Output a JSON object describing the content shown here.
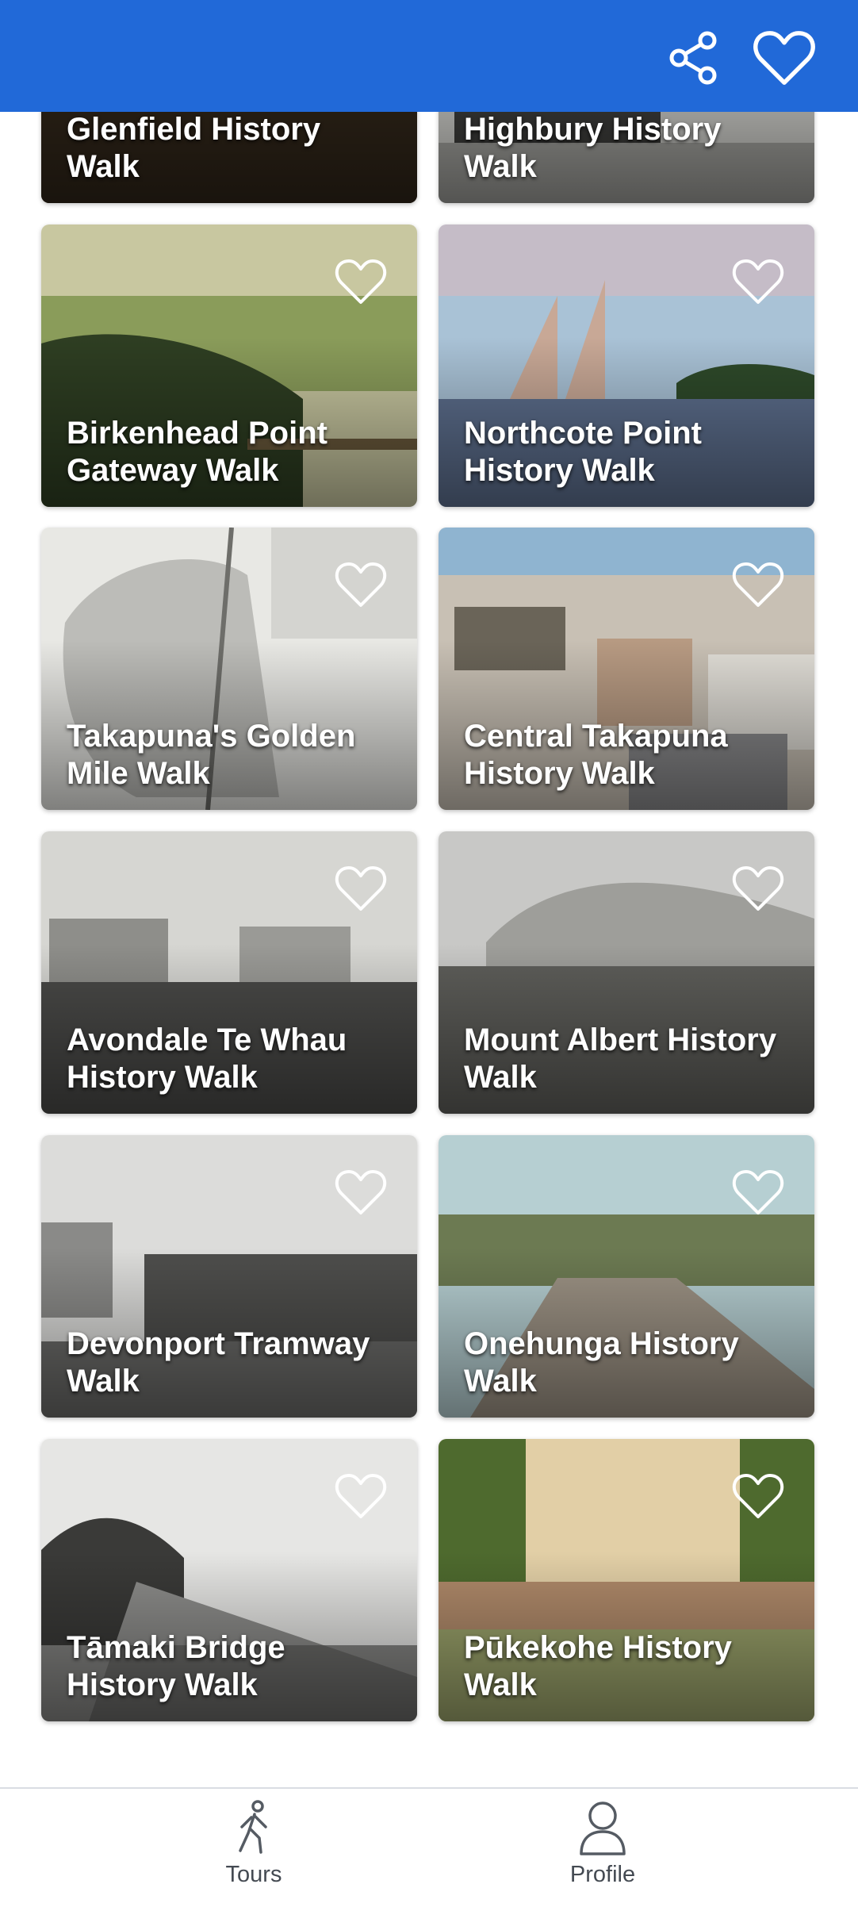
{
  "header": {
    "share_icon": "share-icon",
    "favorite_icon": "heart-outline-icon",
    "color": "#2169d8"
  },
  "tours": [
    {
      "title": "Glenfield History Walk",
      "palette": [
        "#5a4a34",
        "#2e2418",
        "#8a7a5c"
      ]
    },
    {
      "title": "Highbury History Walk",
      "palette": [
        "#9a9a96",
        "#3a3a38",
        "#c4c4c0"
      ]
    },
    {
      "title": "Birkenhead Point Gateway Walk",
      "palette": [
        "#8a9c5a",
        "#2e3e22",
        "#c8c7a0"
      ]
    },
    {
      "title": "Northcote Point History Walk",
      "palette": [
        "#a9c2d6",
        "#5d6f8e",
        "#d9b8bc"
      ]
    },
    {
      "title": "Takapuna's Golden Mile Walk",
      "palette": [
        "#bcbcb8",
        "#6e6e6a",
        "#e8e8e4"
      ]
    },
    {
      "title": "Central Takapuna History Walk",
      "palette": [
        "#8fb4d0",
        "#6a6458",
        "#c8c0b4"
      ]
    },
    {
      "title": "Avondale Te Whau History Walk",
      "palette": [
        "#d6d6d2",
        "#4a4a48",
        "#8e8e8a"
      ]
    },
    {
      "title": "Mount Albert History Walk",
      "palette": [
        "#c8c8c6",
        "#5e5e5a",
        "#9e9e9a"
      ]
    },
    {
      "title": "Devonport Tramway Walk",
      "palette": [
        "#dcdcda",
        "#4e4e4c",
        "#8a8a88"
      ]
    },
    {
      "title": "Onehunga History Walk",
      "palette": [
        "#b6cfd2",
        "#6c7a52",
        "#9c9284"
      ]
    },
    {
      "title": "Tāmaki Bridge History Walk",
      "palette": [
        "#e6e6e4",
        "#3a3a38",
        "#8c8c8a"
      ]
    },
    {
      "title": "Pūkekohe History Walk",
      "palette": [
        "#e2cfa6",
        "#4e6a2e",
        "#9aa26a"
      ]
    }
  ],
  "bottom_nav": {
    "tours_label": "Tours",
    "profile_label": "Profile",
    "tours_icon": "walking-person-icon",
    "profile_icon": "person-icon"
  }
}
